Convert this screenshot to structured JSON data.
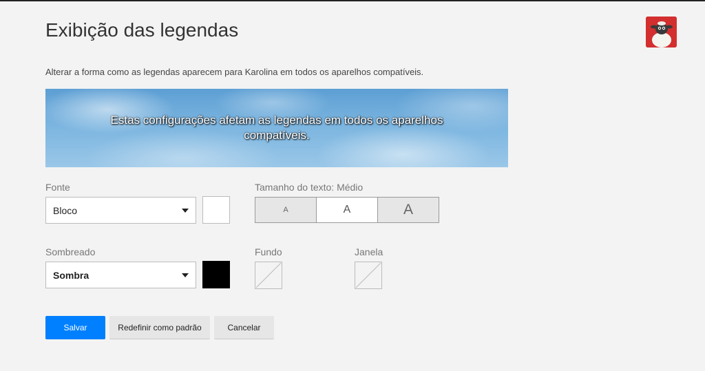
{
  "page": {
    "title": "Exibição das legendas",
    "subtitle": "Alterar a forma como as legendas aparecem para Karolina em todos os aparelhos compatíveis."
  },
  "profile": {
    "avatar_icon": "sheep-avatar-icon",
    "avatar_color": "#c62828"
  },
  "preview": {
    "text": "Estas configurações afetam as legendas em todos os aparelhos compatíveis."
  },
  "font": {
    "label": "Fonte",
    "value": "Bloco",
    "color_swatch": "#ffffff"
  },
  "text_size": {
    "label": "Tamanho do texto: Médio",
    "options": [
      "A",
      "A",
      "A"
    ],
    "selected_index": 1
  },
  "shadow": {
    "label": "Sombreado",
    "value": "Sombra",
    "color_swatch": "#000000"
  },
  "background": {
    "label": "Fundo",
    "color_swatch": "none"
  },
  "window": {
    "label": "Janela",
    "color_swatch": "none"
  },
  "actions": {
    "save": "Salvar",
    "reset": "Redefinir como padrão",
    "cancel": "Cancelar",
    "primary_color": "#0080ff"
  }
}
